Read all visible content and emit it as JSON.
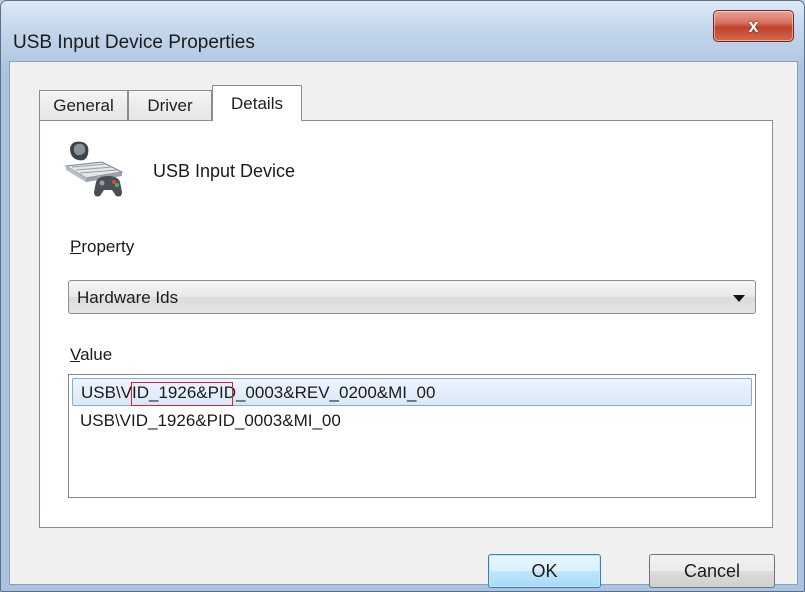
{
  "window": {
    "title": "USB Input Device Properties",
    "close_glyph": "x"
  },
  "tabs": [
    {
      "label": "General",
      "active": false
    },
    {
      "label": "Driver",
      "active": false
    },
    {
      "label": "Details",
      "active": true
    }
  ],
  "device": {
    "name": "USB Input Device",
    "icon": "usb-input-device-icon"
  },
  "property": {
    "label_accesskey": "P",
    "label_rest": "roperty",
    "selected": "Hardware Ids"
  },
  "value": {
    "label_accesskey": "V",
    "label_rest": "alue",
    "items": [
      {
        "text": "USB\\VID_1926&PID_0003&REV_0200&MI_00",
        "selected": true
      },
      {
        "text": "USB\\VID_1926&PID_0003&MI_00",
        "selected": false
      }
    ]
  },
  "buttons": {
    "ok": "OK",
    "cancel": "Cancel"
  },
  "colors": {
    "highlight_box": "#e2202a",
    "selection": "#d8e8fa",
    "close_button": "#c0412d"
  }
}
